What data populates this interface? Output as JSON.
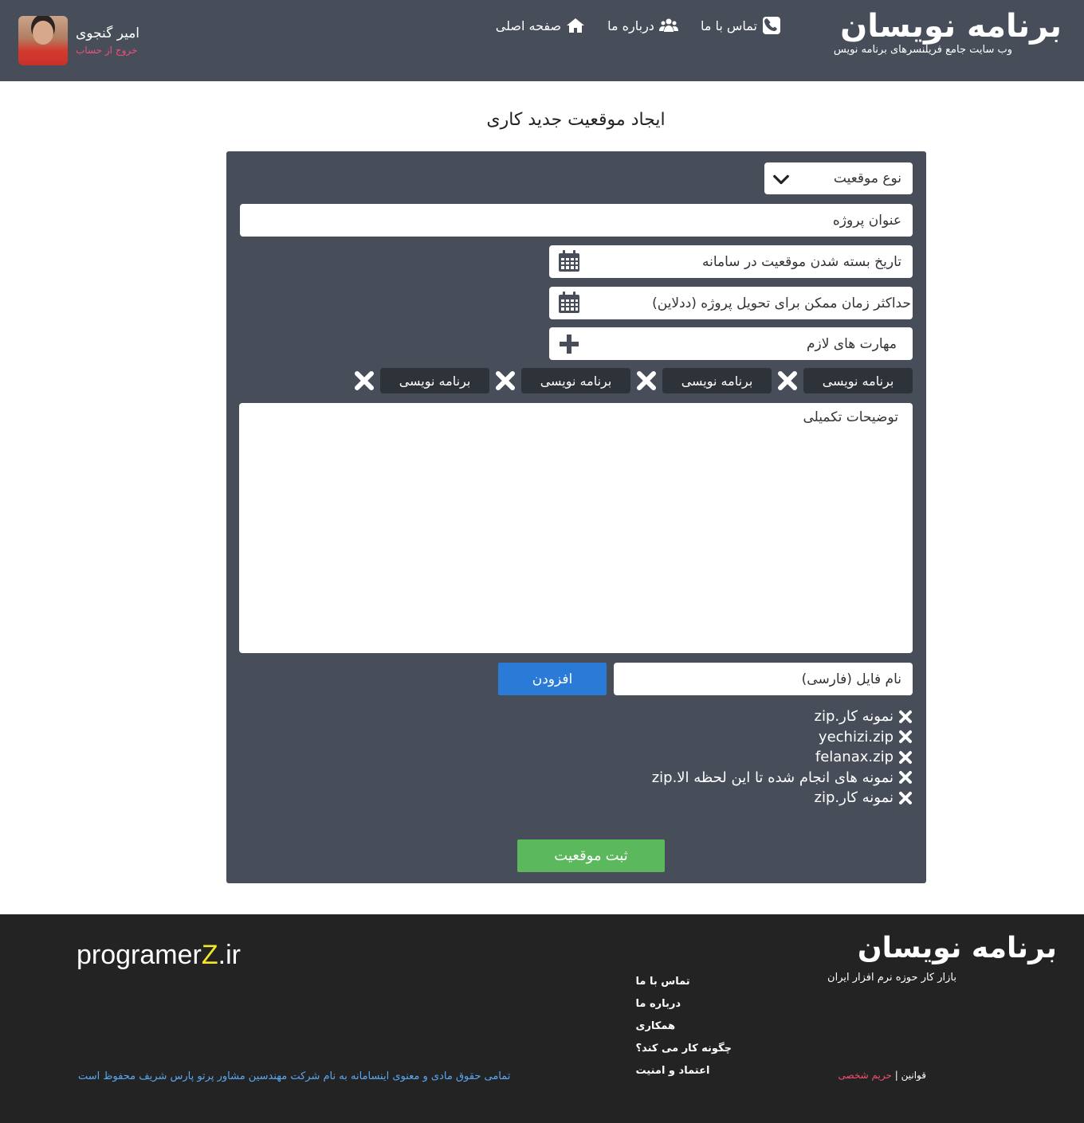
{
  "header": {
    "logo_text": "برنامه نویسان",
    "logo_subtitle": "وب سایت جامع فریلنسرهای برنامه نویس",
    "nav": [
      {
        "label": "صفحه اصلی",
        "icon": "home-icon"
      },
      {
        "label": "درباره ما",
        "icon": "users-icon"
      },
      {
        "label": "تماس با ما",
        "icon": "phone-icon"
      }
    ],
    "user": {
      "name": "امیر گنجوی",
      "logout_label": "خروج از حساب"
    }
  },
  "page": {
    "title": "ایجاد موقعیت جدید کاری"
  },
  "form": {
    "position_type_placeholder": "نوع موقعیت",
    "project_title_placeholder": "عنوان پروژه",
    "close_date_placeholder": "تاریخ بسته شدن موقعیت در سامانه",
    "deadline_placeholder": "حداکثر زمان ممکن برای تحویل پروژه (ددلاین)",
    "skills_placeholder": "مهارت های لازم",
    "skill_tags": [
      "برنامه نویسی",
      "برنامه نویسی",
      "برنامه نویسی",
      "برنامه نویسی"
    ],
    "description_placeholder": "توضیحات تکمیلی",
    "file_name_placeholder": "نام فایل (فارسی)",
    "add_button_label": "افزودن",
    "files": [
      "نمونه کار.zip",
      "yechizi.zip",
      "felanax.zip",
      "نمونه های انجام شده تا این لحظه الا.zip",
      "نمونه کار.zip"
    ],
    "submit_label": "ثبت موقعیت"
  },
  "footer": {
    "logo_text": "برنامه نویسان",
    "logo_subtitle": "بازار کار حوزه نرم افزار ایران",
    "links": [
      "تماس با ما",
      "درباره ما",
      "همکاری",
      "چگونه کار می کند؟",
      "اعتماد و امنیت"
    ],
    "brand_prefix": "programer",
    "brand_z": "Z",
    "brand_suffix": ".ir",
    "copyright": "تمامی حقوق مادی و معنوی اینسامانه به نام شرکت مهندسین مشاور پرتو پارس شریف محفوظ است",
    "rules_label": "قوانین",
    "separator": "|",
    "privacy_label": "حریم شخصی"
  },
  "colors": {
    "header_bg": "#474d59",
    "panel_bg": "#474d59",
    "tag_bg": "#2e3239",
    "add_button": "#2a7bd8",
    "submit_button": "#5cb85c",
    "footer_bg": "#232323",
    "logout_text": "#f0507a",
    "copyright_text": "#5aa8f0",
    "brand_accent": "#f2e52a"
  }
}
